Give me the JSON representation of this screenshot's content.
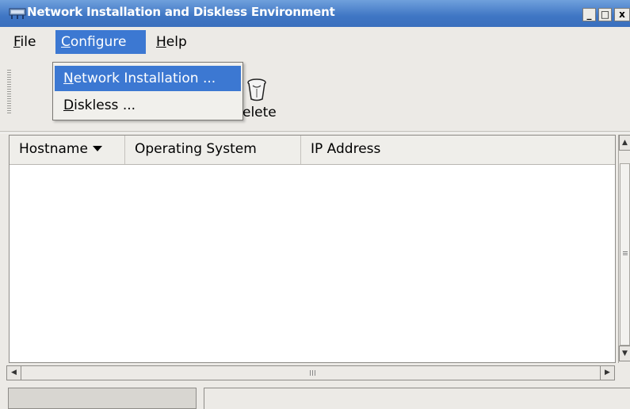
{
  "window": {
    "title": "Network Installation and Diskless Environment",
    "controls": {
      "minimize": "_",
      "maximize": "□",
      "close": "x"
    }
  },
  "menubar": {
    "items": [
      {
        "mnemonic": "F",
        "rest": "ile",
        "label": "File"
      },
      {
        "mnemonic": "C",
        "rest": "onfigure",
        "label": "Configure",
        "active": true
      },
      {
        "mnemonic": "H",
        "rest": "elp",
        "label": "Help"
      }
    ]
  },
  "configure_menu": {
    "items": [
      {
        "mnemonic": "N",
        "rest": "etwork Installation ...",
        "label": "Network Installation ...",
        "highlighted": true
      },
      {
        "mnemonic": "D",
        "rest": "iskless ...",
        "label": "Diskless ..."
      }
    ]
  },
  "toolbar": {
    "delete_label_visible": "elete",
    "delete_icon": "trash-icon"
  },
  "table": {
    "columns": [
      "Hostname",
      "Operating System",
      "IP Address"
    ],
    "sort_column": "Hostname",
    "rows": []
  },
  "scrollbar_glyphs": {
    "h_grip": "III",
    "v_grip": "≡"
  },
  "colors": {
    "titlebar": "#3f76c4",
    "highlight": "#3c78d2"
  }
}
